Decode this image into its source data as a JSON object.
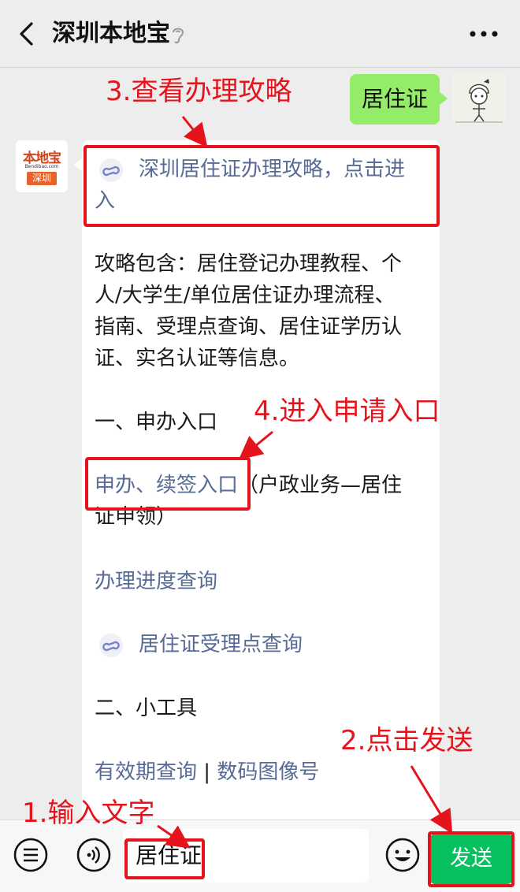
{
  "header": {
    "title": "深圳本地宝"
  },
  "messages": {
    "sent": "居住证",
    "bot_avatar": {
      "brand": "本地宝",
      "url": "Bendibao.com",
      "city": "深圳"
    },
    "reply": {
      "link1_line1": "深圳居住证办理攻略，点击进",
      "link1_line2": "入",
      "desc_lines": [
        "攻略包含：居住登记办理教程、个",
        "人/大学生/单位居住证办理流程、",
        "指南、受理点查询、居住证学历认",
        "证、实名认证等信息。"
      ],
      "section1": "一、申办入口",
      "apply_link": "申办、续签入口",
      "apply_suffix_line1": "（户政业务—居住",
      "apply_suffix_line2": "证申领）",
      "progress_link": "办理进度查询",
      "accept_link": "居住证受理点查询",
      "section2": "二、小工具",
      "tool_link1": "有效期查询",
      "tool_sep": " | ",
      "tool_link2": "数码图像号"
    }
  },
  "annotations": {
    "step1": "1.输入文字",
    "step2": "2.点击发送",
    "step3": "3.查看办理攻略",
    "step4": "4.进入申请入口"
  },
  "input": {
    "value": "居住证",
    "send_label": "发送"
  },
  "colors": {
    "annotation_red": "#e5141c",
    "link_blue": "#576b95",
    "send_green": "#07c160",
    "bubble_green": "#95ec69"
  }
}
